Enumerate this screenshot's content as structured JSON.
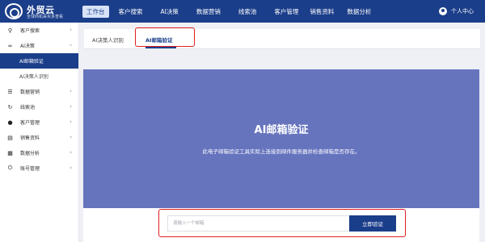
{
  "brand": {
    "name": "外贸云",
    "tagline": "全球商机采买多查看"
  },
  "nav": {
    "items": [
      {
        "label": "工作台",
        "active": true
      },
      {
        "label": "客户搜索"
      },
      {
        "label": "AI决策"
      },
      {
        "label": "数据营销"
      },
      {
        "label": "线索池"
      },
      {
        "label": "客户管理"
      },
      {
        "label": "销售资料"
      },
      {
        "label": "数据分析"
      }
    ],
    "user_label": "个人中心"
  },
  "sidebar": {
    "items": [
      {
        "label": "客户搜索",
        "icon": "search-icon"
      },
      {
        "label": "AI决策",
        "icon": "link-icon",
        "expanded": true,
        "children": [
          {
            "label": "AI邮箱验证",
            "active": true
          },
          {
            "label": "AI决策人识别"
          }
        ]
      },
      {
        "label": "数据营销",
        "icon": "stack-icon"
      },
      {
        "label": "线索池",
        "icon": "refresh-icon"
      },
      {
        "label": "客户管理",
        "icon": "people-icon"
      },
      {
        "label": "销售资料",
        "icon": "document-icon"
      },
      {
        "label": "数据分析",
        "icon": "calendar-icon"
      },
      {
        "label": "账号管理",
        "icon": "power-icon"
      }
    ]
  },
  "tabs": [
    {
      "label": "AI决策人识别"
    },
    {
      "label": "AI邮箱验证",
      "active": true
    }
  ],
  "hero": {
    "title": "AI邮箱验证",
    "description": "此电子邮箱验证工具实际上连接到邮件服务器并检查邮箱是否存在。"
  },
  "search": {
    "placeholder": "请输入一个邮箱",
    "value": "",
    "button_label": "立即验证"
  },
  "colors": {
    "brand": "#1b3e8a",
    "hero": "#6674be",
    "highlight": "#e02020"
  }
}
